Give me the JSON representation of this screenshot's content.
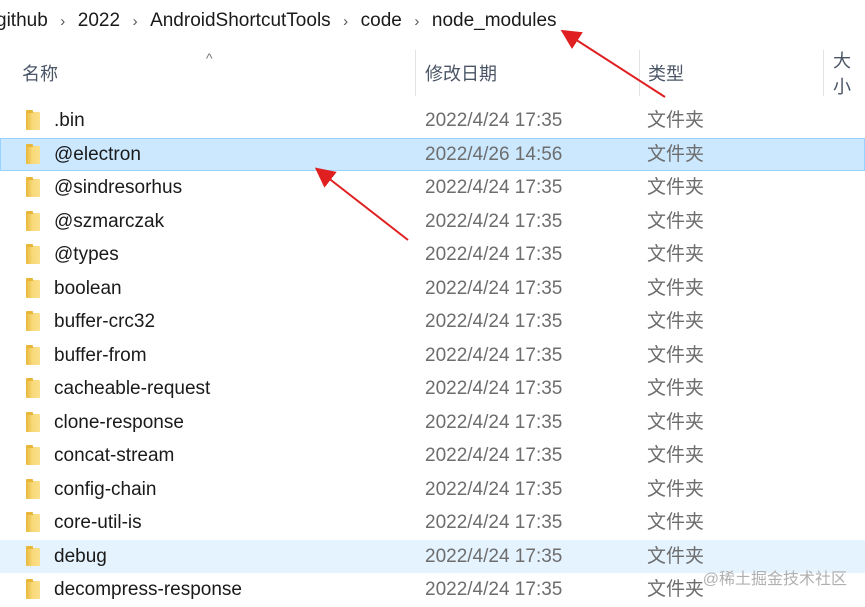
{
  "breadcrumb": [
    "github",
    "2022",
    "AndroidShortcutTools",
    "code",
    "node_modules"
  ],
  "columns": {
    "name": "名称",
    "date": "修改日期",
    "type": "类型",
    "size": "大小"
  },
  "rows": [
    {
      "name": ".bin",
      "date": "2022/4/24 17:35",
      "type": "文件夹"
    },
    {
      "name": "@electron",
      "date": "2022/4/26 14:56",
      "type": "文件夹",
      "state": "selected"
    },
    {
      "name": "@sindresorhus",
      "date": "2022/4/24 17:35",
      "type": "文件夹"
    },
    {
      "name": "@szmarczak",
      "date": "2022/4/24 17:35",
      "type": "文件夹"
    },
    {
      "name": "@types",
      "date": "2022/4/24 17:35",
      "type": "文件夹"
    },
    {
      "name": "boolean",
      "date": "2022/4/24 17:35",
      "type": "文件夹"
    },
    {
      "name": "buffer-crc32",
      "date": "2022/4/24 17:35",
      "type": "文件夹"
    },
    {
      "name": "buffer-from",
      "date": "2022/4/24 17:35",
      "type": "文件夹"
    },
    {
      "name": "cacheable-request",
      "date": "2022/4/24 17:35",
      "type": "文件夹"
    },
    {
      "name": "clone-response",
      "date": "2022/4/24 17:35",
      "type": "文件夹"
    },
    {
      "name": "concat-stream",
      "date": "2022/4/24 17:35",
      "type": "文件夹"
    },
    {
      "name": "config-chain",
      "date": "2022/4/24 17:35",
      "type": "文件夹"
    },
    {
      "name": "core-util-is",
      "date": "2022/4/24 17:35",
      "type": "文件夹"
    },
    {
      "name": "debug",
      "date": "2022/4/24 17:35",
      "type": "文件夹",
      "state": "hovered"
    },
    {
      "name": "decompress-response",
      "date": "2022/4/24 17:35",
      "type": "文件夹"
    }
  ],
  "watermark": "@稀土掘金技术社区",
  "colors": {
    "selected": "#cce8ff",
    "hover": "#e5f3ff",
    "folder": "#f8d878",
    "annotation_arrow": "#e02020"
  }
}
